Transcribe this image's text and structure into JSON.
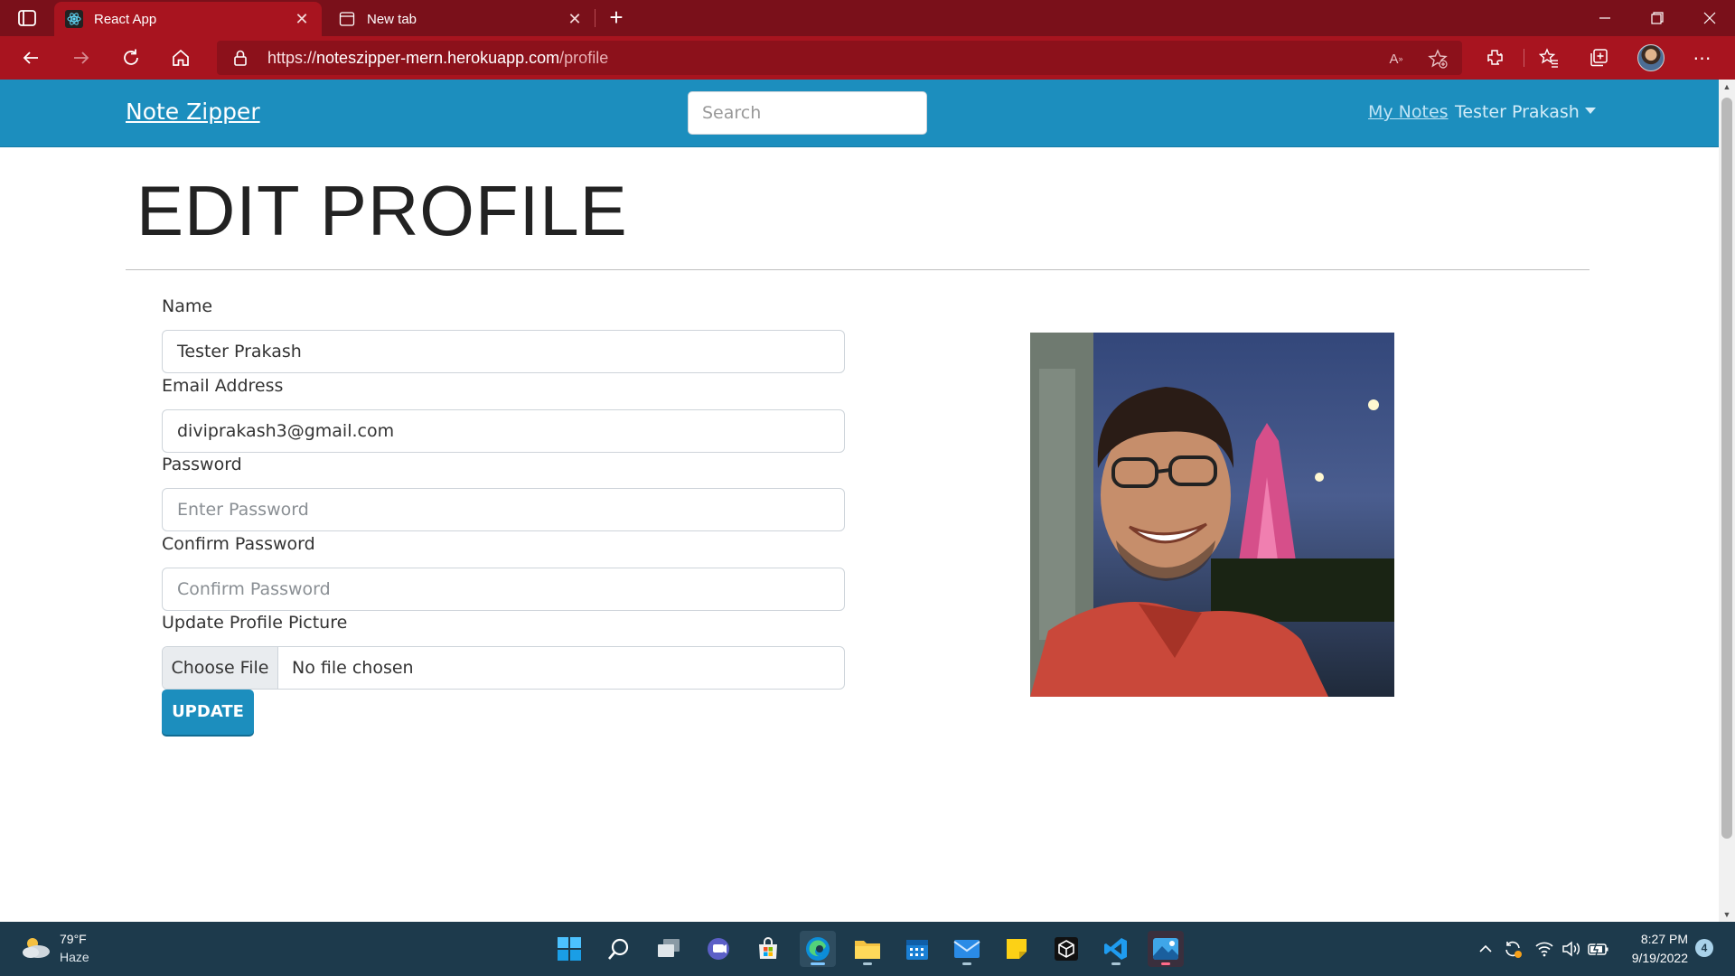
{
  "browser": {
    "tabs": [
      {
        "title": "React App",
        "active": true
      },
      {
        "title": "New tab",
        "active": false
      }
    ],
    "url": {
      "scheme": "https://",
      "host": "noteszipper-mern.herokuapp.com",
      "path": "/profile"
    }
  },
  "app": {
    "brand": "Note Zipper",
    "search_placeholder": "Search",
    "nav_my_notes": "My Notes",
    "nav_user": "Tester Prakash",
    "accent_color": "#1c8ebe"
  },
  "profile": {
    "title": "EDIT PROFILE",
    "name_label": "Name",
    "name_value": "Tester Prakash",
    "email_label": "Email Address",
    "email_value": "diviprakash3@gmail.com",
    "password_label": "Password",
    "password_placeholder": "Enter Password",
    "confirm_label": "Confirm Password",
    "confirm_placeholder": "Confirm Password",
    "picture_label": "Update Profile Picture",
    "choose_file": "Choose File",
    "no_file": "No file chosen",
    "update_button": "UPDATE"
  },
  "taskbar": {
    "weather_temp": "79°F",
    "weather_desc": "Haze",
    "time": "8:27 PM",
    "date": "9/19/2022",
    "notification_count": "4"
  }
}
